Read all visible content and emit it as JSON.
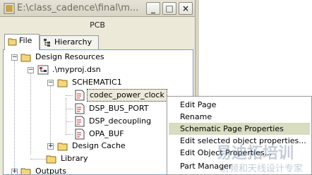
{
  "window": {
    "title": "E:\\class_cadence\\final\\m...",
    "minimize_glyph": "_",
    "maximize_glyph": "□",
    "close_glyph": "×"
  },
  "panel": {
    "label": "PCB"
  },
  "tabs": [
    {
      "label": "File",
      "icon": "file-tab-icon",
      "active": true
    },
    {
      "label": "Hierarchy",
      "icon": "hierarchy-icon",
      "active": false
    }
  ],
  "tree": {
    "design_resources": "Design Resources",
    "design_file": ".\\myproj.dsn",
    "schematic": "SCHEMATIC1",
    "pages": [
      {
        "label": "codec_power_clock",
        "selected": true
      },
      {
        "label": "DSP_BUS_PORT",
        "selected": false
      },
      {
        "label": "DSP_decoupling",
        "selected": false
      },
      {
        "label": "OPA_BUF",
        "selected": false
      }
    ],
    "design_cache": "Design Cache",
    "library": "Library",
    "outputs": "Outputs"
  },
  "context_menu": {
    "items": [
      {
        "label": "Edit Page",
        "highlighted": false
      },
      {
        "label": "Rename",
        "highlighted": false
      },
      {
        "label": "Schematic Page Properties",
        "highlighted": true
      },
      {
        "label": "Edit selected object properties...",
        "highlighted": false
      },
      {
        "label": "Edit Object Properties...",
        "highlighted": false
      },
      {
        "label": "Part Manager",
        "highlighted": false
      }
    ]
  },
  "watermark": {
    "text_main": "易迪拓培训",
    "text_sub": "射频和天线设计专家"
  },
  "colors": {
    "menu_highlight": "#d8dcc0",
    "panel_bg": "#ece9d8",
    "folder_yellow": "#f5d77a"
  }
}
